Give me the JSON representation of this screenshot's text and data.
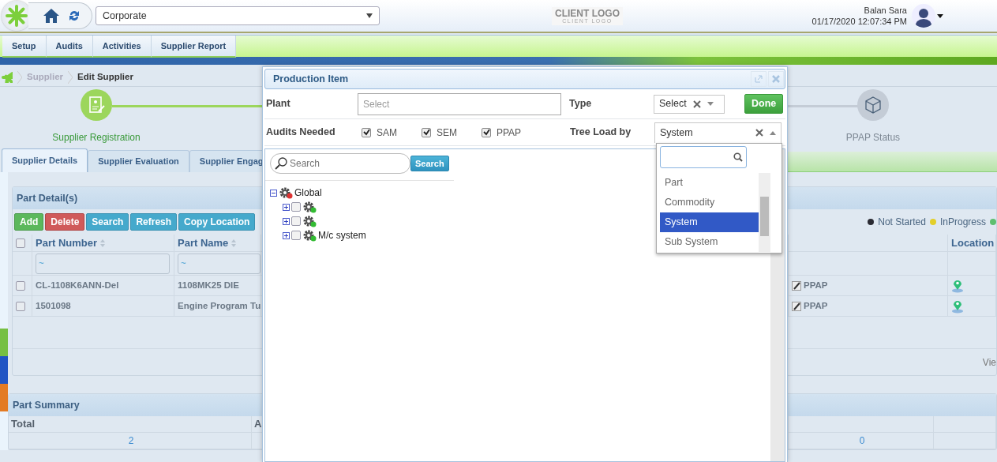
{
  "header": {
    "site_selector": "Corporate",
    "client_logo": {
      "title": "CLIENT LOGO",
      "subtitle": "CLIENT LOGO"
    },
    "user": {
      "name": "Balan Sara",
      "datetime": "01/17/2020 12:07:34 PM"
    }
  },
  "menu": [
    {
      "label": "Setup"
    },
    {
      "label": "Audits"
    },
    {
      "label": "Activities"
    },
    {
      "label": "Supplier Report"
    }
  ],
  "breadcrumb": [
    "Supplier",
    "Edit Supplier"
  ],
  "steps": [
    {
      "label": "Supplier Registration",
      "done": true
    },
    {
      "label": "PPAP Status",
      "done": false
    }
  ],
  "tabs": [
    {
      "label": "Supplier Details",
      "selected": true
    },
    {
      "label": "Supplier Evaluation",
      "selected": false
    },
    {
      "label": "Supplier Engag",
      "selected": false
    }
  ],
  "part_details": {
    "title": "Part Detail(s)",
    "buttons": [
      {
        "label": "Add",
        "kind": "success"
      },
      {
        "label": "Delete",
        "kind": "danger"
      },
      {
        "label": "Search",
        "kind": "info"
      },
      {
        "label": "Refresh",
        "kind": "info"
      },
      {
        "label": "Copy Location",
        "kind": "info"
      }
    ],
    "legend": [
      {
        "label": "Not Started",
        "color": "#2b2b33"
      },
      {
        "label": "InProgress",
        "color": "#e3cf2a"
      },
      {
        "color": "#5fbf6f"
      }
    ],
    "columns": [
      "Part Number",
      "Part Name",
      "Location"
    ],
    "select_all": false,
    "filters": [
      "~",
      "~"
    ],
    "rows": [
      {
        "checked": false,
        "part_number": "CL-1108K6ANN-Del",
        "part_name": "1108MK25 DIE",
        "audit": "PPAP"
      },
      {
        "checked": false,
        "part_number": "1501098",
        "part_name": "Engine Program Tu",
        "audit": "PPAP"
      }
    ],
    "pager_text": "Vie"
  },
  "part_summary": {
    "title": "Part Summary",
    "columns": [
      "Total",
      "A"
    ],
    "values": [
      "2",
      "0"
    ]
  },
  "modal": {
    "title": "Production Item",
    "plant": {
      "label": "Plant",
      "placeholder": "Select"
    },
    "type": {
      "label": "Type",
      "value": "Select"
    },
    "done": "Done",
    "audits": {
      "label": "Audits Needed",
      "options": [
        {
          "label": "SAM",
          "checked": true
        },
        {
          "label": "SEM",
          "checked": true
        },
        {
          "label": "PPAP",
          "checked": true
        }
      ]
    },
    "tree_load": {
      "label": "Tree Load by",
      "value": "System",
      "options": [
        {
          "label": "Part",
          "selected": false
        },
        {
          "label": "Commodity",
          "selected": false
        },
        {
          "label": "System",
          "selected": true
        },
        {
          "label": "Sub System",
          "selected": false
        }
      ]
    },
    "search": {
      "placeholder": "Search",
      "button": "Search"
    },
    "tree": [
      {
        "label": "Global",
        "expanded": true,
        "children": [
          {
            "checked": false,
            "expanded": false
          },
          {
            "checked": false,
            "expanded": false
          },
          {
            "label": "M/c system",
            "checked": false,
            "expanded": false
          }
        ]
      }
    ]
  }
}
